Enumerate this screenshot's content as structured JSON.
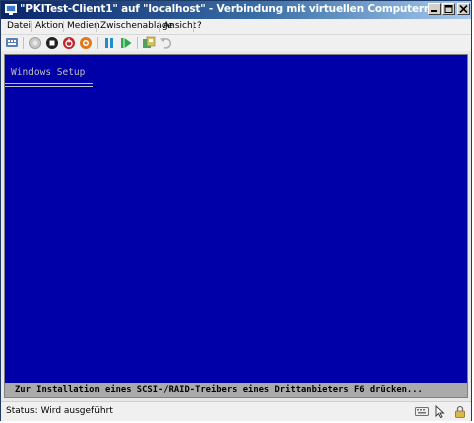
{
  "window": {
    "title": "\"PKITest-Client1\" auf \"localhost\" - Verbindung mit virtuellen Computern"
  },
  "menu": {
    "items": [
      "Datei",
      "Aktion",
      "Medien",
      "Zwischenablage",
      "Ansicht",
      "?"
    ]
  },
  "toolbar": {
    "buttons": [
      {
        "icon": "ctrl-alt-del-icon"
      },
      {
        "icon": "start-icon"
      },
      {
        "icon": "turn-off-icon"
      },
      {
        "icon": "shutdown-icon"
      },
      {
        "icon": "save-icon"
      },
      {
        "icon": "pause-icon"
      },
      {
        "icon": "reset-icon"
      },
      {
        "icon": "snapshot-icon"
      },
      {
        "icon": "revert-icon"
      }
    ]
  },
  "vm_screen": {
    "background": "#0000a8",
    "heading": "Windows Setup",
    "footer": "Zur Installation eines SCSI-/RAID-Treibers eines Drittanbieters F6 drücken..."
  },
  "status": {
    "text": "Status: Wird ausgeführt",
    "icons": [
      "keyboard-icon",
      "mouse-icon",
      "lock-icon"
    ]
  }
}
